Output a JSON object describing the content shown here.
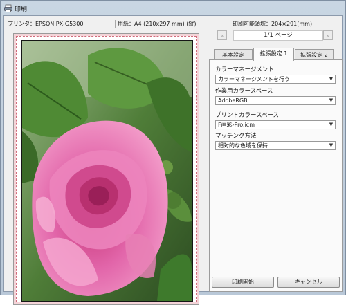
{
  "window": {
    "title": "印刷",
    "title_icon": "printer-icon"
  },
  "infobar": {
    "printer_label": "プリンタ：",
    "printer_value": "EPSON PX-G5300",
    "paper_label": "用紙：",
    "paper_value": "A4 (210x297 mm) (縦)",
    "printable_label": "印刷可能領域：",
    "printable_value": "204×291(mm)"
  },
  "pager": {
    "prev_label": "«",
    "page_label": "1/1 ページ",
    "next_label": "»"
  },
  "tabs": [
    {
      "label": "基本設定",
      "active": false
    },
    {
      "label": "拡張設定 1",
      "active": true
    },
    {
      "label": "拡張設定 2",
      "active": false
    }
  ],
  "settings": {
    "color_management": {
      "label": "カラーマネージメント",
      "value": "カラーマネージメントを行う"
    },
    "working_space": {
      "label": "作業用カラースペース",
      "value": "AdobeRGB"
    },
    "print_space": {
      "label": "プリントカラースペース",
      "value": "F画彩-Pro.icm"
    },
    "matching": {
      "label": "マッチング方法",
      "value": "相対的な色域を保持"
    }
  },
  "buttons": {
    "print_start": "印刷開始",
    "cancel": "キャンセル"
  },
  "colors": {
    "accent": "#d06a7a",
    "photo_pink": "#e0589c",
    "leaf_green": "#5a8a3c"
  }
}
